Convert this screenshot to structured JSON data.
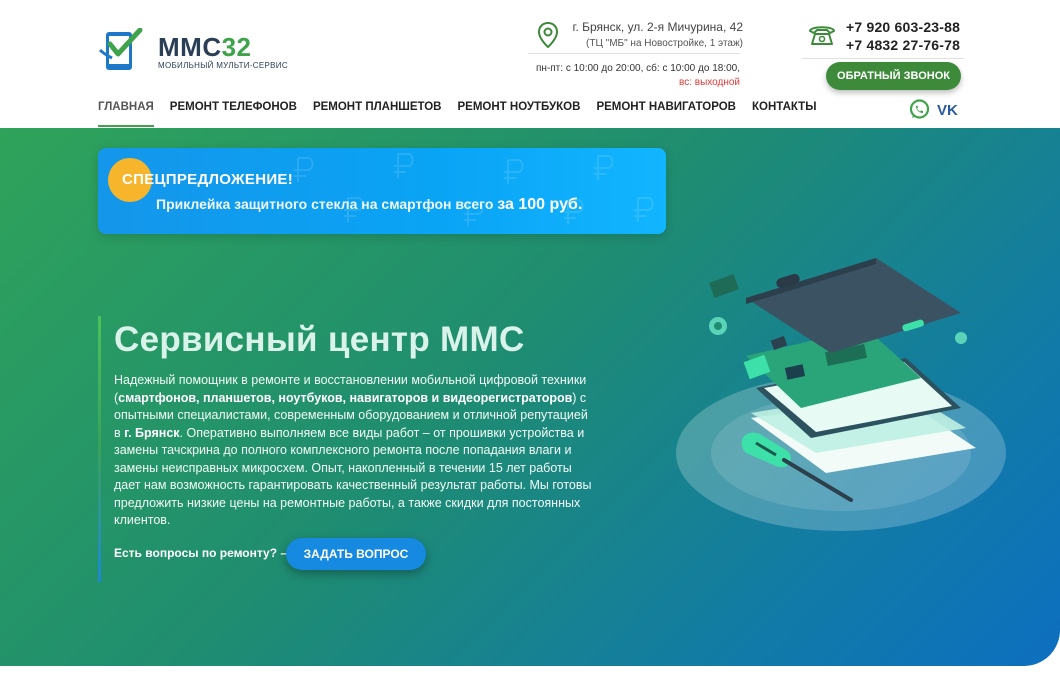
{
  "logo": {
    "brand_main": "ММС",
    "brand_num": "32",
    "subtitle": "МОБИЛЬНЫЙ МУЛЬТИ-СЕРВИС"
  },
  "address": {
    "line1": "г. Брянск, ул. 2-я Мичурина, 42",
    "line2": "(ТЦ \"МБ\" на Новостройке, 1 этаж)",
    "hours": "пн-пт: с 10:00 до 20:00, сб: с 10:00 до 18:00,",
    "day_off": "вс: выходной"
  },
  "contacts": {
    "phone1": "+7 920 603-23-88",
    "phone2": "+7 4832 27-76-78",
    "callback_label": "ОБРАТНЫЙ ЗВОНОК"
  },
  "nav": {
    "items": [
      {
        "label": "ГЛАВНАЯ",
        "active": true
      },
      {
        "label": "РЕМОНТ ТЕЛЕФОНОВ"
      },
      {
        "label": "РЕМОНТ ПЛАНШЕТОВ"
      },
      {
        "label": "РЕМОНТ НОУТБУКОВ"
      },
      {
        "label": "РЕМОНТ НАВИГАТОРОВ"
      },
      {
        "label": "КОНТАКТЫ"
      }
    ]
  },
  "social": {
    "vk_label": "VK"
  },
  "promo": {
    "title": "СПЕЦПРЕДЛОЖЕНИЕ!",
    "text": "Приклейка защитного стекла на смартфон всего",
    "price": "за 100 руб."
  },
  "hero": {
    "title": "Сервисный центр ММС",
    "desc_1": "Надежный помощник в ремонте и восстановлении мобильной цифровой техники (",
    "desc_bold_1": "смартфонов, планшетов, ноутбуков, навигаторов и видеорегистраторов",
    "desc_2": ") с опытными специалистами, современным оборудованием и отличной репутацией в ",
    "desc_bold_2": "г. Брянск",
    "desc_3": ". Оперативно выполняем все виды работ – от прошивки устройства и замены тачскрина до полного комплексного ремонта после попадания влаги и замены неисправных микросхем. Опыт, накопленный в течении 15 лет работы дает нам возможность гарантировать качественный результат работы. Мы готовы предложить низкие цены на ремонтные работы, а также скидки для постоянных клиентов.",
    "ask_label": "Есть вопросы по ремонту? –",
    "ask_button": "ЗАДАТЬ ВОПРОС"
  },
  "colors": {
    "green": "#3ea34a",
    "blue": "#1689e0",
    "accent_orange": "#f7b52c",
    "red": "#e53935"
  }
}
